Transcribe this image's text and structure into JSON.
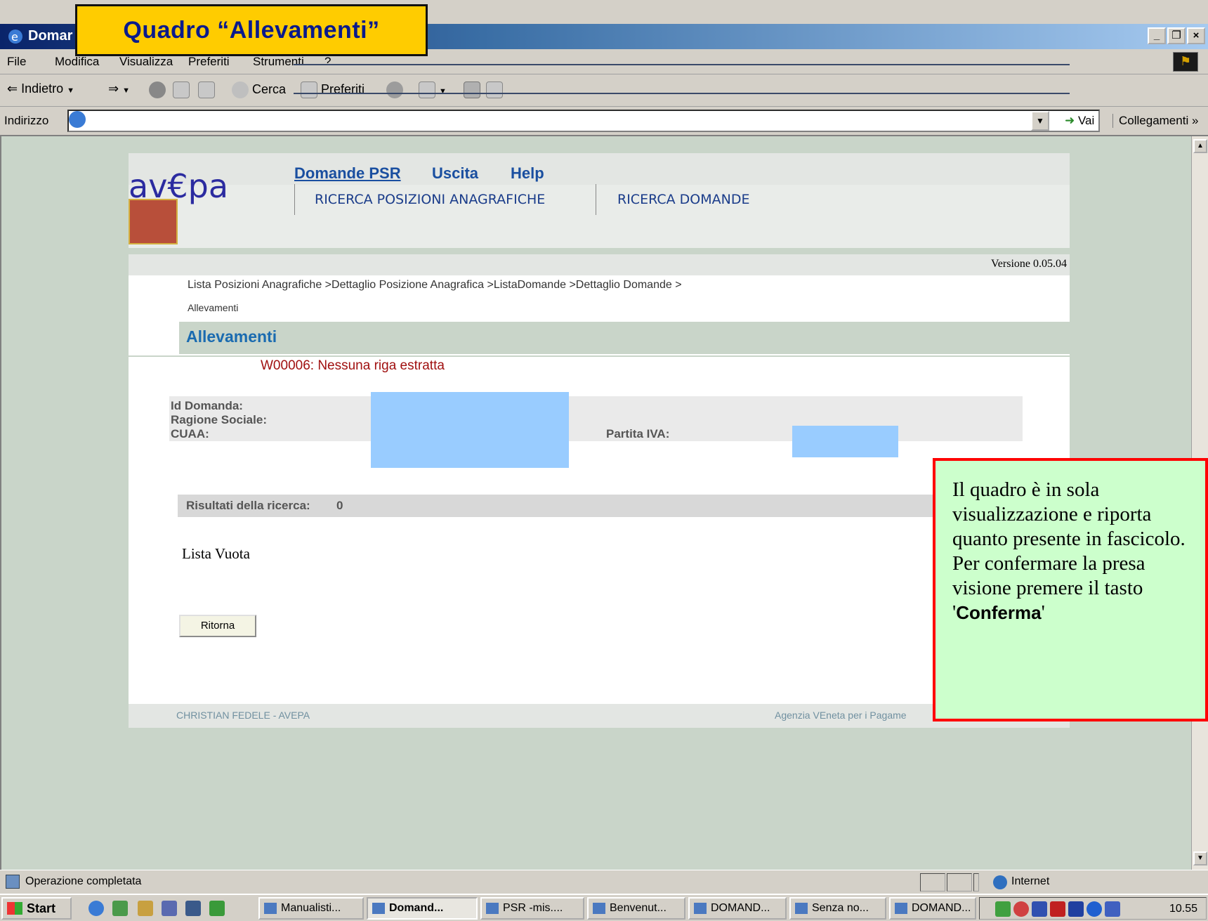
{
  "window": {
    "title": "Domar",
    "overlay_label": "Quadro “Allevamenti”",
    "minimize": "_",
    "maximize": "❐",
    "close": "×"
  },
  "menu": [
    "File",
    "Modifica",
    "Visualizza",
    "Preferiti",
    "Strumenti",
    "?"
  ],
  "toolbar": {
    "back": "Indietro",
    "search": "Cerca",
    "favorites": "Preferiti"
  },
  "address": {
    "label": "Indirizzo",
    "value": "",
    "go": "Vai",
    "links": "Collegamenti"
  },
  "portal": {
    "logo": "av€pa",
    "nav": [
      "Domande PSR",
      "Uscita",
      "Help"
    ],
    "tabs": [
      "RICERCA POSIZIONI ANAGRAFICHE",
      "RICERCA DOMANDE"
    ],
    "version": "Versione 0.05.04"
  },
  "page": {
    "breadcrumb": "Lista Posizioni Anagrafiche >Dettaglio Posizione Anagrafica >ListaDomande >Dettaglio Domande >",
    "breadcrumb_current": "Allevamenti",
    "section_title": "Allevamenti",
    "message": "W00006: Nessuna riga estratta",
    "info": {
      "id_domanda": "Id Domanda:",
      "ragione_sociale": "Ragione Sociale:",
      "cuaa": "CUAA:",
      "partita_iva": "Partita IVA:"
    },
    "results_label": "Risultati della ricerca:",
    "results_count": "0",
    "empty_list": "Lista Vuota",
    "return_button": "Ritorna",
    "footer_left": "CHRISTIAN FEDELE - AVEPA",
    "footer_right": "Agenzia VEneta per i Pagame"
  },
  "callout": {
    "text": "Il quadro è in sola visualizzazione e riporta quanto presente in fascicolo. Per confermare la presa visione premere il tasto",
    "quote_open": "'",
    "button_name": "Conferma",
    "quote_close": "'"
  },
  "status": {
    "text": "Operazione completata",
    "zone": "Internet"
  },
  "taskbar": {
    "start": "Start",
    "tasks": [
      "Manualisti...",
      "Domand...",
      "PSR -mis....",
      "Benvenut...",
      "DOMAND...",
      "Senza no...",
      "DOMAND..."
    ],
    "clock": "10.55"
  },
  "colors": {
    "overlay_bg": "#ffcc00",
    "callout_bg": "#ccffcc",
    "callout_border": "#ff0000",
    "redacted": "#99ccff",
    "title_link": "#1a6bb0"
  }
}
